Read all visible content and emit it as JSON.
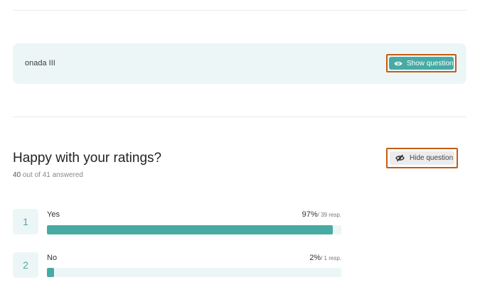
{
  "hidden_question": {
    "title": "onada III",
    "show_label": "Show question",
    "icon": "eye-icon"
  },
  "question": {
    "title": "Happy with your ratings?",
    "answered_count": "40",
    "answered_rest": " out of 41 answered",
    "hide_label": "Hide question",
    "hide_icon": "eye-slash-icon",
    "options": [
      {
        "index": "1",
        "label": "Yes",
        "percent_text": "97%",
        "resp_text": "/ 39 resp.",
        "fraction": 0.97
      },
      {
        "index": "2",
        "label": "No",
        "percent_text": "2%",
        "resp_text": "/ 1 resp.",
        "fraction": 0.025
      }
    ]
  },
  "colors": {
    "accent": "#47aba4",
    "highlight_border": "#c45c14",
    "panel_bg": "#edf6f7"
  }
}
